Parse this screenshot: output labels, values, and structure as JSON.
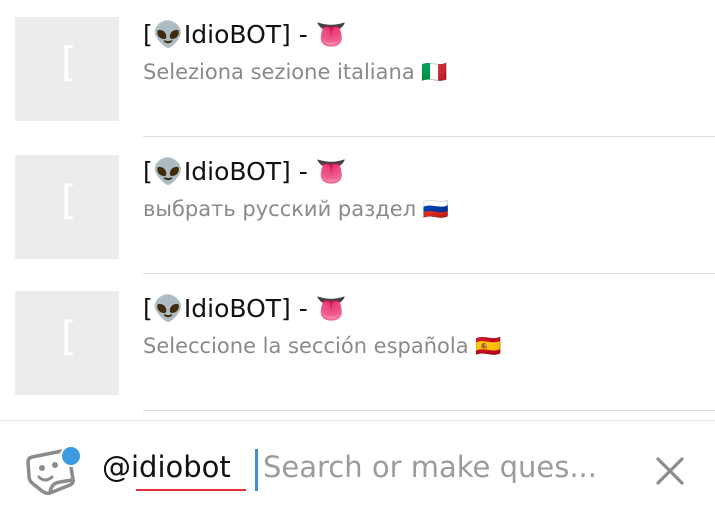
{
  "results": [
    {
      "title": "[👽IdioBOT] - 👅",
      "description": "Seleziona sezione italiana 🇮🇹",
      "thumb_glyph": "["
    },
    {
      "title": "[👽IdioBOT] - 👅",
      "description": "выбрать русский раздел 🇷🇺",
      "thumb_glyph": "["
    },
    {
      "title": "[👽IdioBOT] - 👅",
      "description": "Seleccione la sección española 🇪🇸",
      "thumb_glyph": "["
    }
  ],
  "composer": {
    "mention": "@idiobot",
    "placeholder": "Search or make ques...",
    "sticker_icon": "sticker-face-icon",
    "close_icon": "close-icon"
  },
  "colors": {
    "caret": "#3d8fd6",
    "badge": "#3d9be0",
    "mention_underline": "#e0313a",
    "placeholder": "#9c9c9c",
    "description": "#8a8a8a"
  }
}
